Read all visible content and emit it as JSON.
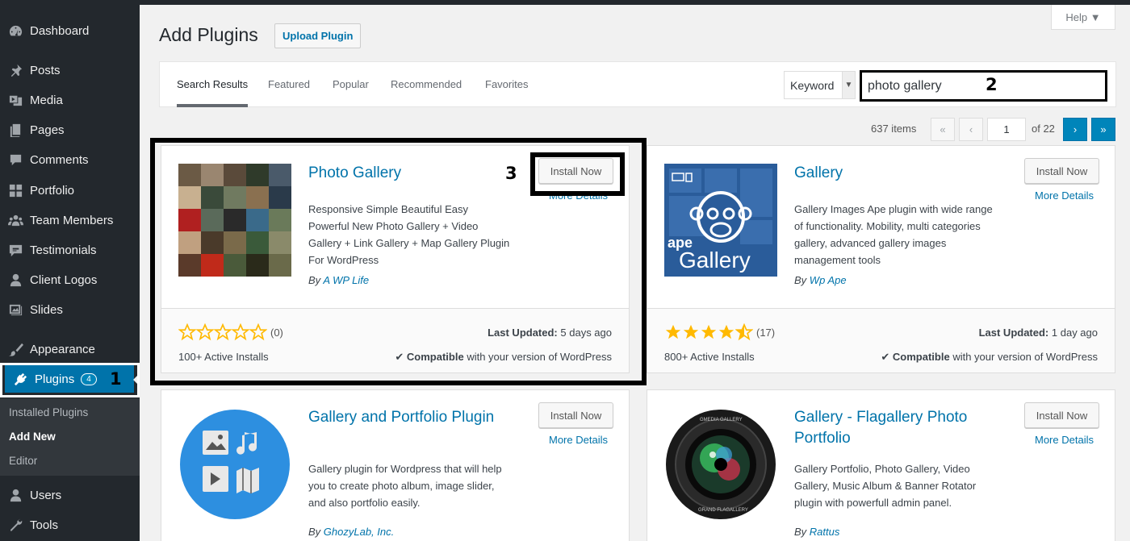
{
  "sidebar": {
    "items": [
      {
        "label": "Dashboard",
        "icon": "dashboard-icon"
      },
      {
        "label": "Posts",
        "icon": "pin-icon"
      },
      {
        "label": "Media",
        "icon": "media-icon"
      },
      {
        "label": "Pages",
        "icon": "pages-icon"
      },
      {
        "label": "Comments",
        "icon": "comments-icon"
      },
      {
        "label": "Portfolio",
        "icon": "grid-icon"
      },
      {
        "label": "Team Members",
        "icon": "groups-icon"
      },
      {
        "label": "Testimonials",
        "icon": "testimonial-icon"
      },
      {
        "label": "Client Logos",
        "icon": "user-icon"
      },
      {
        "label": "Slides",
        "icon": "slides-icon"
      },
      {
        "label": "Appearance",
        "icon": "brush-icon"
      },
      {
        "label": "Plugins",
        "icon": "plugin-icon",
        "badge": "4"
      },
      {
        "label": "Users",
        "icon": "users-icon"
      },
      {
        "label": "Tools",
        "icon": "tools-icon"
      }
    ],
    "submenu": [
      "Installed Plugins",
      "Add New",
      "Editor"
    ]
  },
  "header": {
    "title": "Add Plugins",
    "upload_label": "Upload Plugin",
    "help_label": "Help ▼"
  },
  "filter": {
    "tabs": [
      "Search Results",
      "Featured",
      "Popular",
      "Recommended",
      "Favorites"
    ],
    "keyword_label": "Keyword",
    "search_value": "photo gallery"
  },
  "pagination": {
    "items": "637 items",
    "first": "«",
    "prev": "‹",
    "current": "1",
    "of": "of 22",
    "next": "›",
    "last": "»"
  },
  "annotations": {
    "one": "1",
    "two": "2",
    "three": "3"
  },
  "cards": [
    {
      "title": "Photo Gallery",
      "description": "Responsive Simple Beautiful Easy Powerful New Photo Gallery + Video Gallery + Link Gallery + Map Gallery Plugin For WordPress",
      "by": "By",
      "author": "A WP Life",
      "install": "Install Now",
      "more": "More Details",
      "rating_count": "(0)",
      "stars": 0,
      "installs": "100+ Active Installs",
      "updated_label": "Last Updated:",
      "updated_value": "5 days ago",
      "compatible_label": "Compatible",
      "compatible_rest": "with your version of WordPress"
    },
    {
      "title": "Gallery",
      "description": "Gallery Images Ape plugin with wide range of functionality. Mobility, multi categories gallery, advanced gallery images management tools",
      "by": "By",
      "author": "Wp Ape",
      "install": "Install Now",
      "more": "More Details",
      "rating_count": "(17)",
      "stars": 4.5,
      "installs": "800+ Active Installs",
      "updated_label": "Last Updated:",
      "updated_value": "1 day ago",
      "compatible_label": "Compatible",
      "compatible_rest": "with your version of WordPress",
      "logo_text_top": "ape",
      "logo_text_bottom": "Gallery"
    },
    {
      "title": "Gallery and Portfolio Plugin",
      "description": "Gallery plugin for Wordpress that will help you to create photo album, image slider, and also portfolio easily.",
      "by": "By",
      "author": "GhozyLab, Inc.",
      "install": "Install Now",
      "more": "More Details"
    },
    {
      "title": "Gallery - Flagallery Photo Portfolio",
      "description": "Gallery Portfolio, Photo Gallery, Video Gallery, Music Album & Banner Rotator plugin with powerfull admin panel.",
      "by": "By",
      "author": "Rattus",
      "install": "Install Now",
      "more": "More Details",
      "lens_top": "GMEDIA GALLERY",
      "lens_bottom": "GRAND FLAGALLERY"
    }
  ],
  "colors": {
    "accent": "#0073aa",
    "sidebar": "#23282d",
    "star": "#ffb900"
  }
}
